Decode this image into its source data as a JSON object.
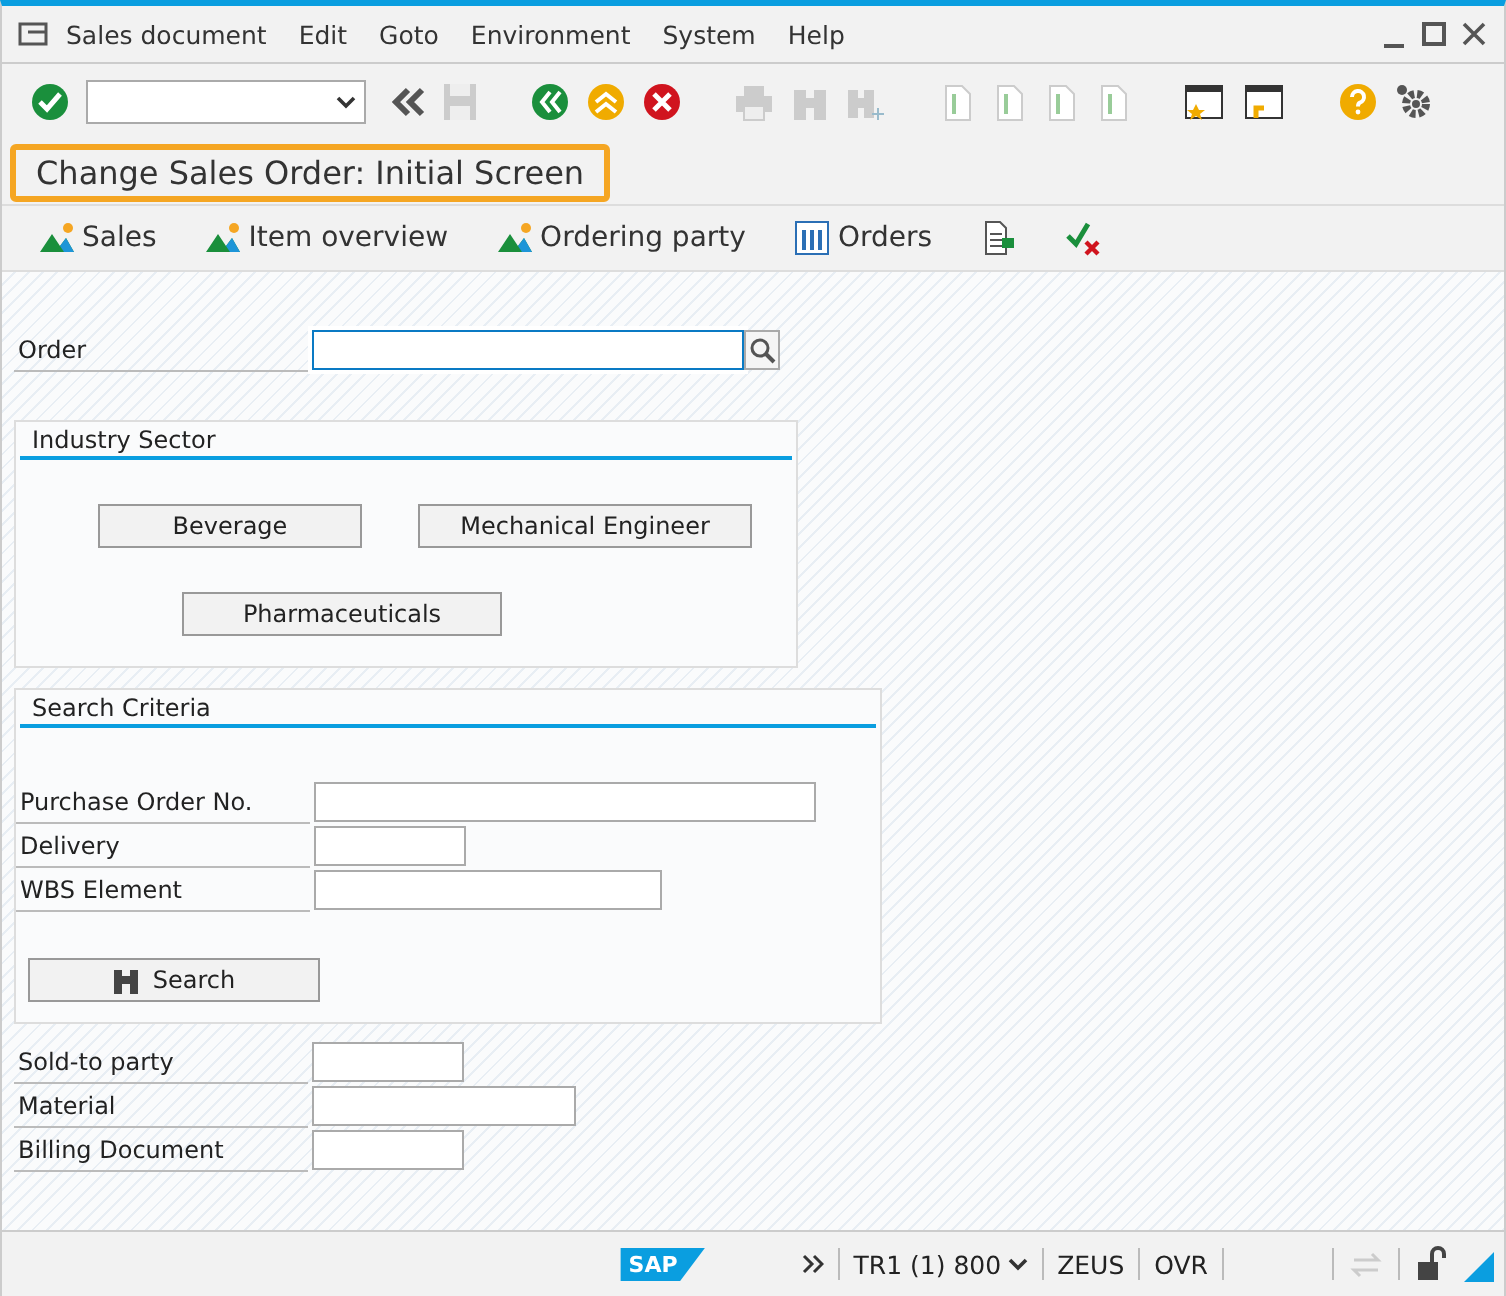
{
  "menu": [
    "Sales document",
    "Edit",
    "Goto",
    "Environment",
    "System",
    "Help"
  ],
  "title": "Change Sales Order: Initial Screen",
  "app_toolbar": [
    {
      "kind": "party",
      "label": "Sales"
    },
    {
      "kind": "party",
      "label": "Item overview"
    },
    {
      "kind": "party",
      "label": "Ordering party"
    },
    {
      "kind": "grid",
      "label": "Orders"
    },
    {
      "kind": "doc"
    },
    {
      "kind": "check"
    }
  ],
  "order_field": {
    "label": "Order"
  },
  "industry_sector": {
    "title": "Industry Sector",
    "buttons": [
      "Beverage",
      "Mechanical Engineer",
      "Pharmaceuticals"
    ]
  },
  "search_criteria": {
    "title": "Search Criteria",
    "fields": [
      {
        "label": "Purchase Order No."
      },
      {
        "label": "Delivery"
      },
      {
        "label": "WBS Element"
      }
    ],
    "button": "Search"
  },
  "fields": [
    {
      "label": "Sold-to party"
    },
    {
      "label": "Material"
    },
    {
      "label": "Billing Document"
    }
  ],
  "status_bar": {
    "logo": "SAP",
    "system": "TR1 (1) 800",
    "user": "ZEUS",
    "mode": "OVR"
  }
}
